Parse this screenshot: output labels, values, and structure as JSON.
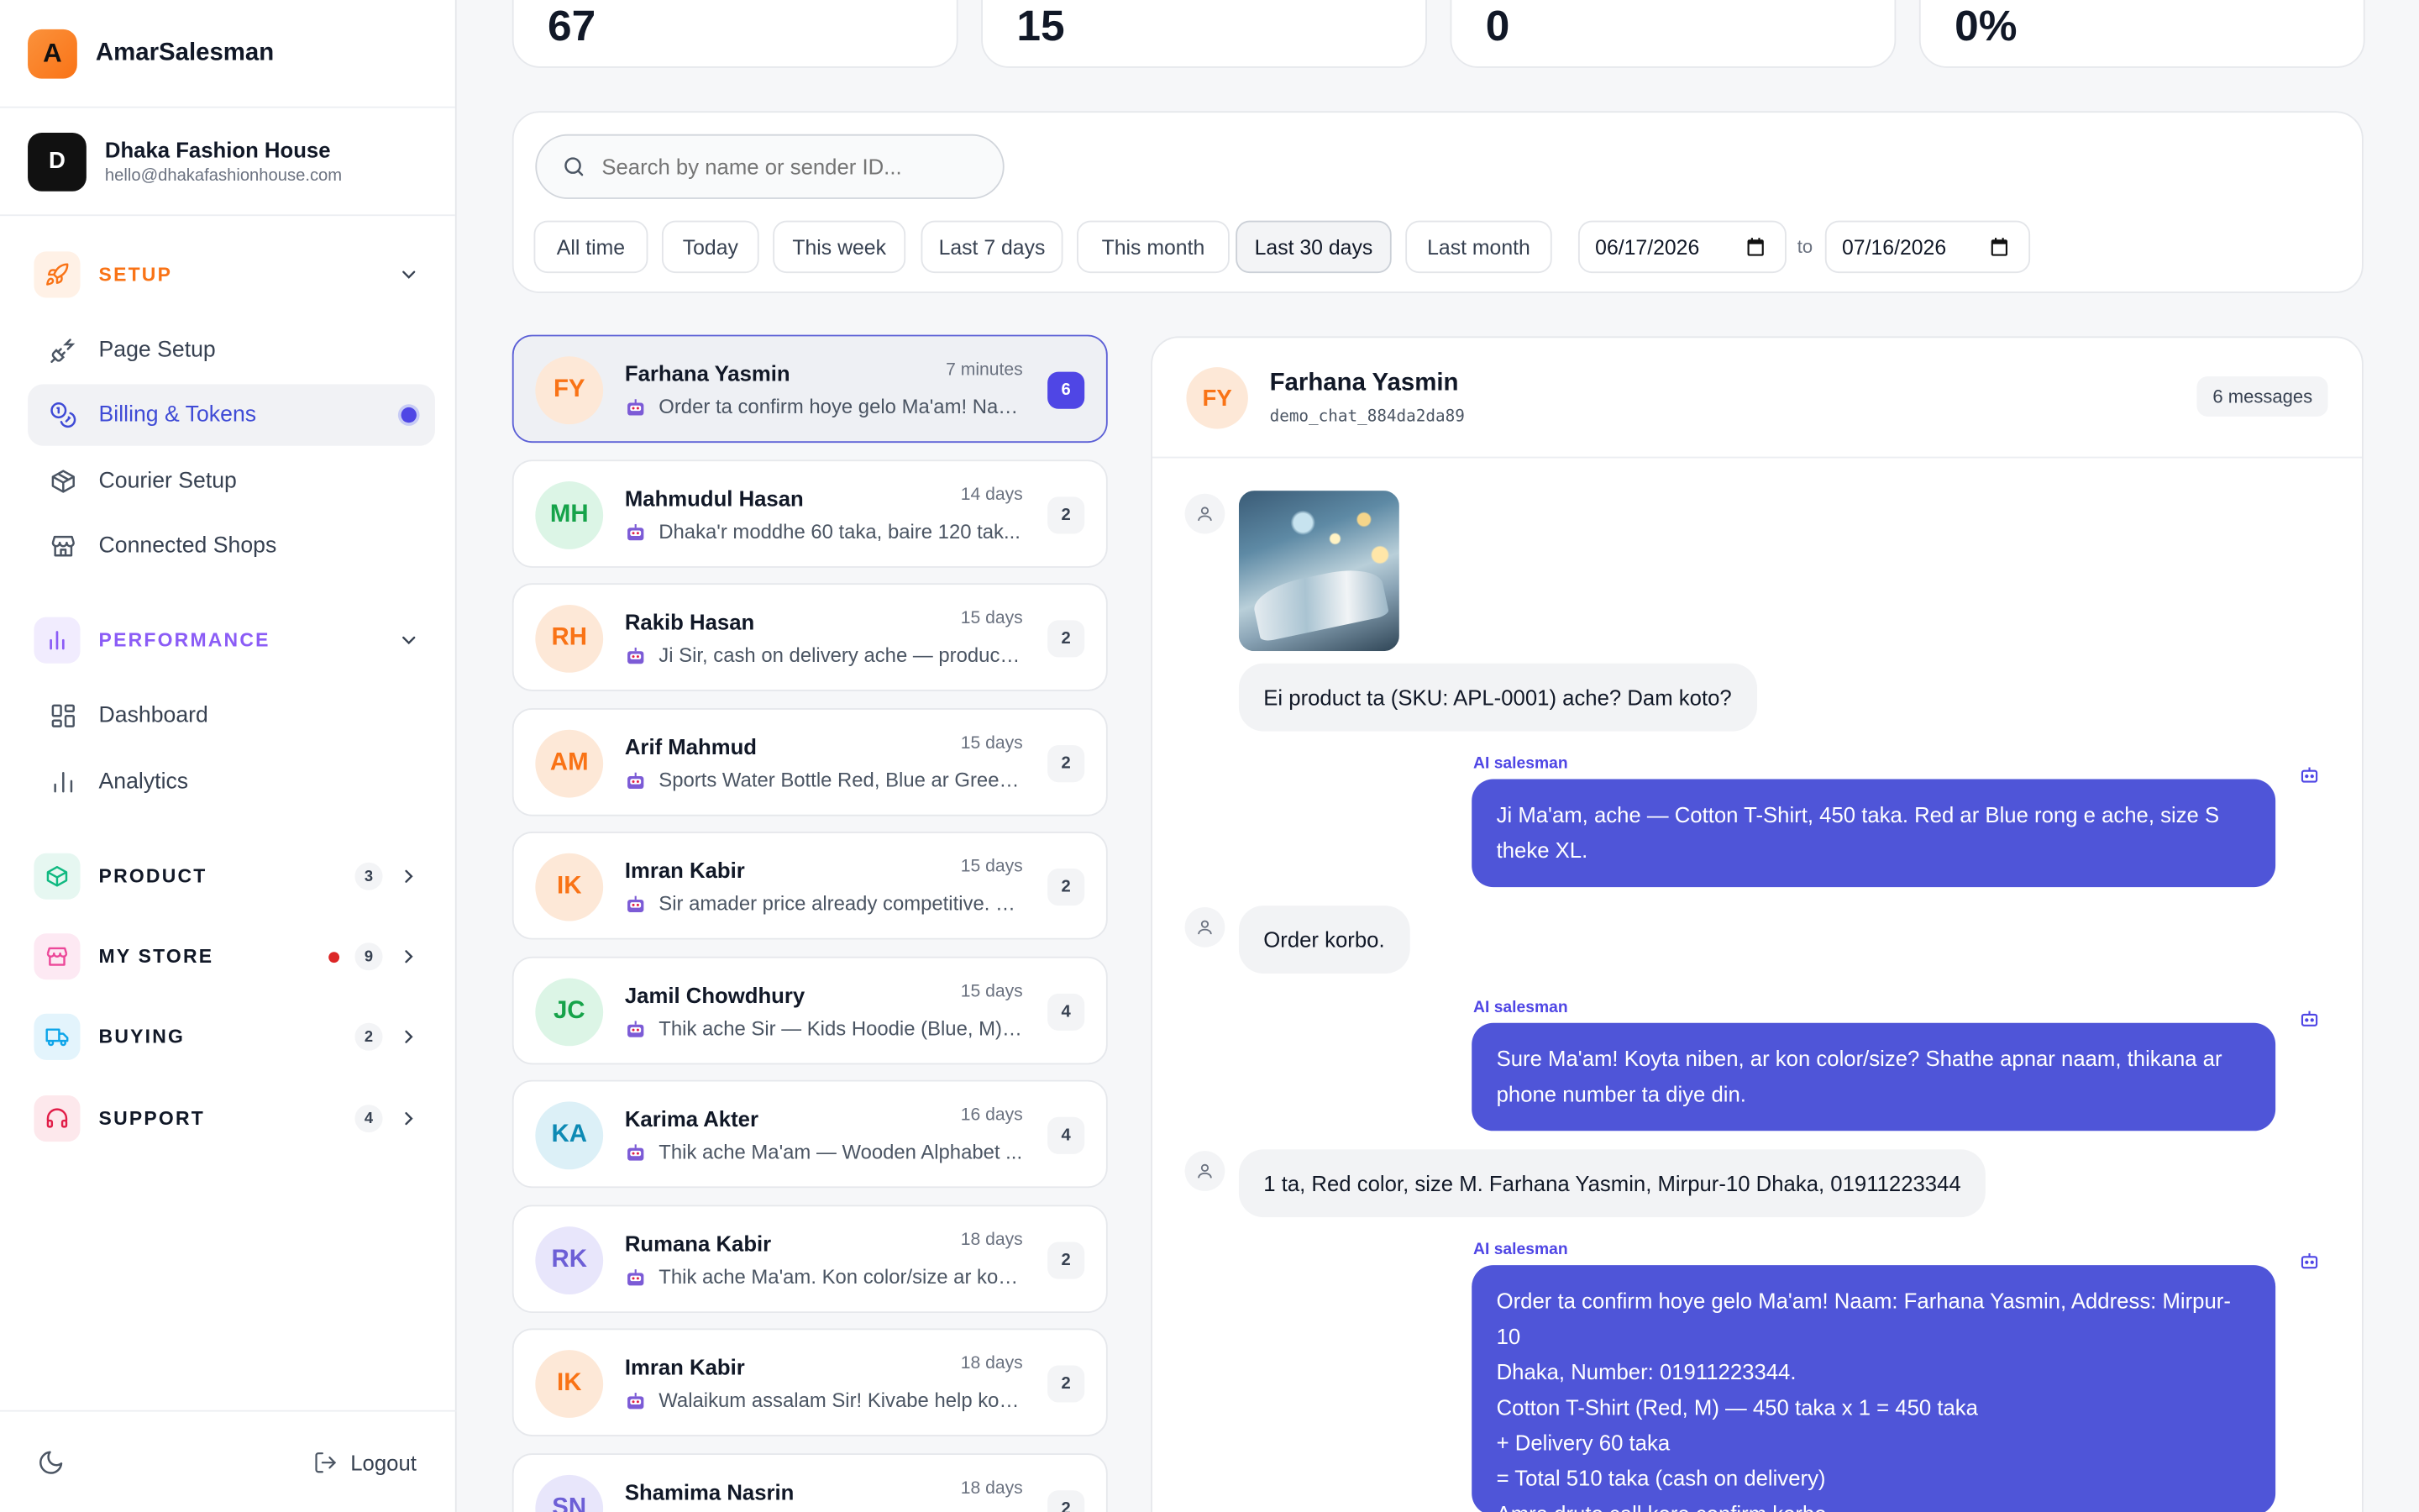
{
  "brand": {
    "logo_letter": "A",
    "name": "AmarSalesman"
  },
  "shop": {
    "avatar": "D",
    "name": "Dhaka Fashion House",
    "email": "hello@dhakafashionhouse.com"
  },
  "nav": {
    "setup": {
      "label": "SETUP",
      "color": "#f97316",
      "items": [
        "Page Setup",
        "Billing & Tokens",
        "Courier Setup",
        "Connected Shops"
      ]
    },
    "performance": {
      "label": "PERFORMANCE",
      "color": "#8b5cf6",
      "items": [
        "Dashboard",
        "Analytics"
      ]
    },
    "product": {
      "label": "PRODUCT",
      "badge": "3",
      "color": "#10b981"
    },
    "my_store": {
      "label": "MY STORE",
      "badge": "9",
      "color": "#ec4899"
    },
    "buying": {
      "label": "BUYING",
      "badge": "2",
      "color": "#0ea5e9"
    },
    "support": {
      "label": "SUPPORT",
      "badge": "4",
      "color": "#e11d48"
    }
  },
  "footer": {
    "logout": "Logout"
  },
  "stats": [
    "67",
    "15",
    "0",
    "0%"
  ],
  "filters": {
    "search_placeholder": "Search by name or sender ID...",
    "chips": [
      "All time",
      "Today",
      "This week",
      "Last 7 days",
      "This month",
      "Last 30 days",
      "Last month"
    ],
    "selected": "Last 30 days",
    "date_from": "06/17/2026",
    "to": "to",
    "date_to": "07/16/2026"
  },
  "conversations": [
    {
      "initials": "FY",
      "name": "Farhana Yasmin",
      "time": "7 minutes",
      "preview": "Order ta confirm hoye gelo Ma'am! Naam",
      "count": "6",
      "selected": true
    },
    {
      "initials": "MH",
      "name": "Mahmudul Hasan",
      "time": "14 days",
      "preview": "Dhaka'r moddhe 60 taka, baire 120 tak...",
      "count": "2"
    },
    {
      "initials": "RH",
      "name": "Rakib Hasan",
      "time": "15 days",
      "preview": "Ji Sir, cash on delivery ache — product ...",
      "count": "2"
    },
    {
      "initials": "AM",
      "name": "Arif Mahmud",
      "time": "15 days",
      "preview": "Sports Water Bottle Red, Blue ar Green ...",
      "count": "2"
    },
    {
      "initials": "IK",
      "name": "Imran Kabir",
      "time": "15 days",
      "preview": "Sir amader price already competitive. C...",
      "count": "2"
    },
    {
      "initials": "JC",
      "name": "Jamil Chowdhury",
      "time": "15 days",
      "preview": "Thik ache Sir — Kids Hoodie (Blue, M) x...",
      "count": "4"
    },
    {
      "initials": "KA",
      "name": "Karima Akter",
      "time": "16 days",
      "preview": "Thik ache Ma'am — Wooden Alphabet ...",
      "count": "4"
    },
    {
      "initials": "RK",
      "name": "Rumana Kabir",
      "time": "18 days",
      "preview": "Thik ache Ma'am. Kon color/size ar koy...",
      "count": "2"
    },
    {
      "initials": "IK",
      "name": "Imran Kabir",
      "time": "18 days",
      "preview": "Walaikum assalam Sir! Kivabe help kort...",
      "count": "2"
    },
    {
      "initials": "SN",
      "name": "Shamima Nasrin",
      "time": "18 days",
      "preview": "",
      "count": "2"
    }
  ],
  "chat": {
    "avatar": "FY",
    "name": "Farhana Yasmin",
    "sender_id": "demo_chat_884da2da89",
    "message_count": "6 messages",
    "ai_label": "AI salesman",
    "messages": {
      "m1": "Ei product ta (SKU: APL-0001) ache? Dam koto?",
      "m2_l1": "Ji Ma'am, ache — Cotton T-Shirt, 450 taka. Red ar Blue rong e ache, size S",
      "m2_l2": "theke XL.",
      "m3": "Order korbo.",
      "m4_l1": "Sure Ma'am! Koyta niben, ar kon color/size? Shathe apnar naam, thikana ar",
      "m4_l2": "phone number ta diye din.",
      "m5": "1 ta, Red color, size M. Farhana Yasmin, Mirpur-10 Dhaka, 01911223344",
      "m6_l1": "Order ta confirm hoye gelo Ma'am! Naam: Farhana Yasmin, Address: Mirpur-10",
      "m6_l2": "Dhaka, Number: 01911223344.",
      "m6_l3": "Cotton T-Shirt (Red, M) — 450 taka x 1 = 450 taka",
      "m6_l4": "+ Delivery 60 taka",
      "m6_l5": "= Total 510 taka (cash on delivery)",
      "m6_l6": "Amra druto call kore confirm korbo."
    }
  }
}
